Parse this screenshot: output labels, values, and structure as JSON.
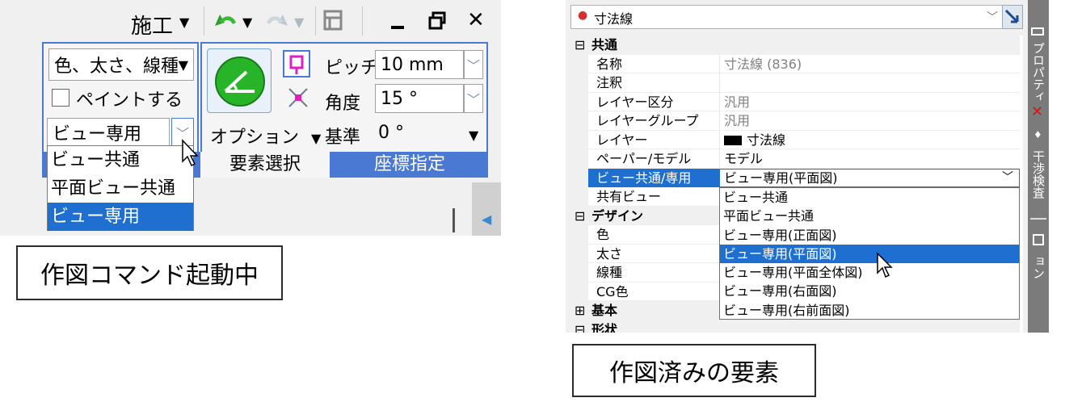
{
  "ribbon": {
    "menu_title": "施工",
    "group_combo_value": "色、太さ、線種",
    "paint_checkbox_label": "ペイントする",
    "view_combo_value": "ビュー専用",
    "pitch_label": "ピッチ",
    "pitch_value": "10 mm",
    "angle_label": "角度",
    "angle_value": "15 °",
    "option_label": "オプション",
    "base_label": "基準",
    "base_value": "0 °",
    "footer_element_select": "要素選択",
    "footer_coord_input": "座標指定",
    "view_dropdown": [
      "ビュー共通",
      "平面ビュー共通",
      "ビュー専用"
    ],
    "view_dropdown_selected": "ビュー専用"
  },
  "caption_left": "作図コマンド起動中",
  "properties": {
    "object_selector": "寸法線",
    "categories": {
      "common": "共通",
      "design": "デザイン",
      "basic": "基本",
      "shape": "形状"
    },
    "rows": [
      {
        "name": "名称",
        "value": "寸法線 (836)"
      },
      {
        "name": "注釈",
        "value": ""
      },
      {
        "name": "レイヤー区分",
        "value": "汎用"
      },
      {
        "name": "レイヤーグループ",
        "value": "汎用"
      },
      {
        "name": "レイヤー",
        "value": "寸法線"
      },
      {
        "name": "ペーパー/モデル",
        "value": "モデル"
      },
      {
        "name": "ビュー共通/専用",
        "value": "ビュー専用(平面図)"
      },
      {
        "name": "共有ビュー",
        "value": ""
      }
    ],
    "design_rows": [
      "色",
      "太さ",
      "線種",
      "CG色"
    ],
    "view_dropdown": [
      "ビュー共通",
      "平面ビュー共通",
      "ビュー専用(正面図)",
      "ビュー専用(平面図)",
      "ビュー専用(平面全体図)",
      "ビュー専用(右面図)",
      "ビュー専用(右前面図)"
    ],
    "view_dropdown_selected": "ビュー専用(平面図)",
    "side_tabs": [
      "プロパティ",
      "干渉検査",
      "シミュレーション"
    ]
  },
  "caption_right": "作図済みの要素",
  "colors": {
    "ribbon_blue": "#4a79d4",
    "selection_blue": "#1e6fd0",
    "side_tab_gray": "#7b7b7b",
    "close_red": "#e01010"
  }
}
